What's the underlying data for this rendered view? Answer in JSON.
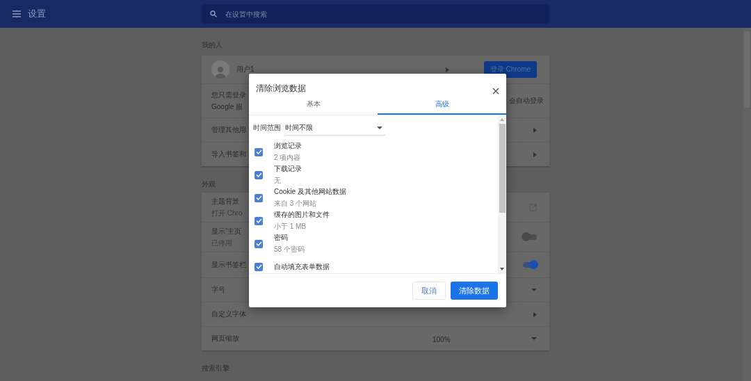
{
  "header": {
    "title": "设置",
    "search": {
      "placeholder": "在设置中搜索"
    }
  },
  "sections": [
    {
      "title": "我的人",
      "rows": [
        {
          "kind": "profile",
          "label": "用户1",
          "button": "登录 Chrome"
        },
        {
          "kind": "note",
          "lines": [
            "您只需登录",
            "Google 服"
          ],
          "trailing": "会自动登录"
        },
        {
          "kind": "link",
          "label": "管理其他用"
        },
        {
          "kind": "link",
          "label": "导入书签和"
        }
      ]
    },
    {
      "title": "外观",
      "rows": [
        {
          "kind": "external",
          "label": "主题背景",
          "sub": "打开 Chro"
        },
        {
          "kind": "toggle",
          "label": "显示“主页",
          "sub": "已停用",
          "on": false
        },
        {
          "kind": "toggle",
          "label": "显示书签栏",
          "on": true
        },
        {
          "kind": "select",
          "label": "字号"
        },
        {
          "kind": "link",
          "label": "自定义字体"
        },
        {
          "kind": "select",
          "label": "网页缩放",
          "value": "100%"
        }
      ]
    },
    {
      "title": "搜索引擎"
    }
  ],
  "dialog": {
    "title": "清除浏览数据",
    "tabs": [
      {
        "label": "基本",
        "selected": false
      },
      {
        "label": "高级",
        "selected": true
      }
    ],
    "time_range": {
      "label": "时间范围",
      "value": "时间不限"
    },
    "items": [
      {
        "label": "浏览记录",
        "sub": "2 项内容",
        "checked": true
      },
      {
        "label": "下载记录",
        "sub": "无",
        "checked": true
      },
      {
        "label": "Cookie 及其他网站数据",
        "sub": "来自 3 个网站",
        "checked": true
      },
      {
        "label": "缓存的图片和文件",
        "sub": "小于 1 MB",
        "checked": true
      },
      {
        "label": "密码",
        "sub": "58 个密码",
        "checked": true
      },
      {
        "label": "自动填充表单数据",
        "checked": true
      }
    ],
    "buttons": [
      {
        "label": "取消",
        "kind": "secondary"
      },
      {
        "label": "清除数据",
        "kind": "primary"
      }
    ]
  }
}
